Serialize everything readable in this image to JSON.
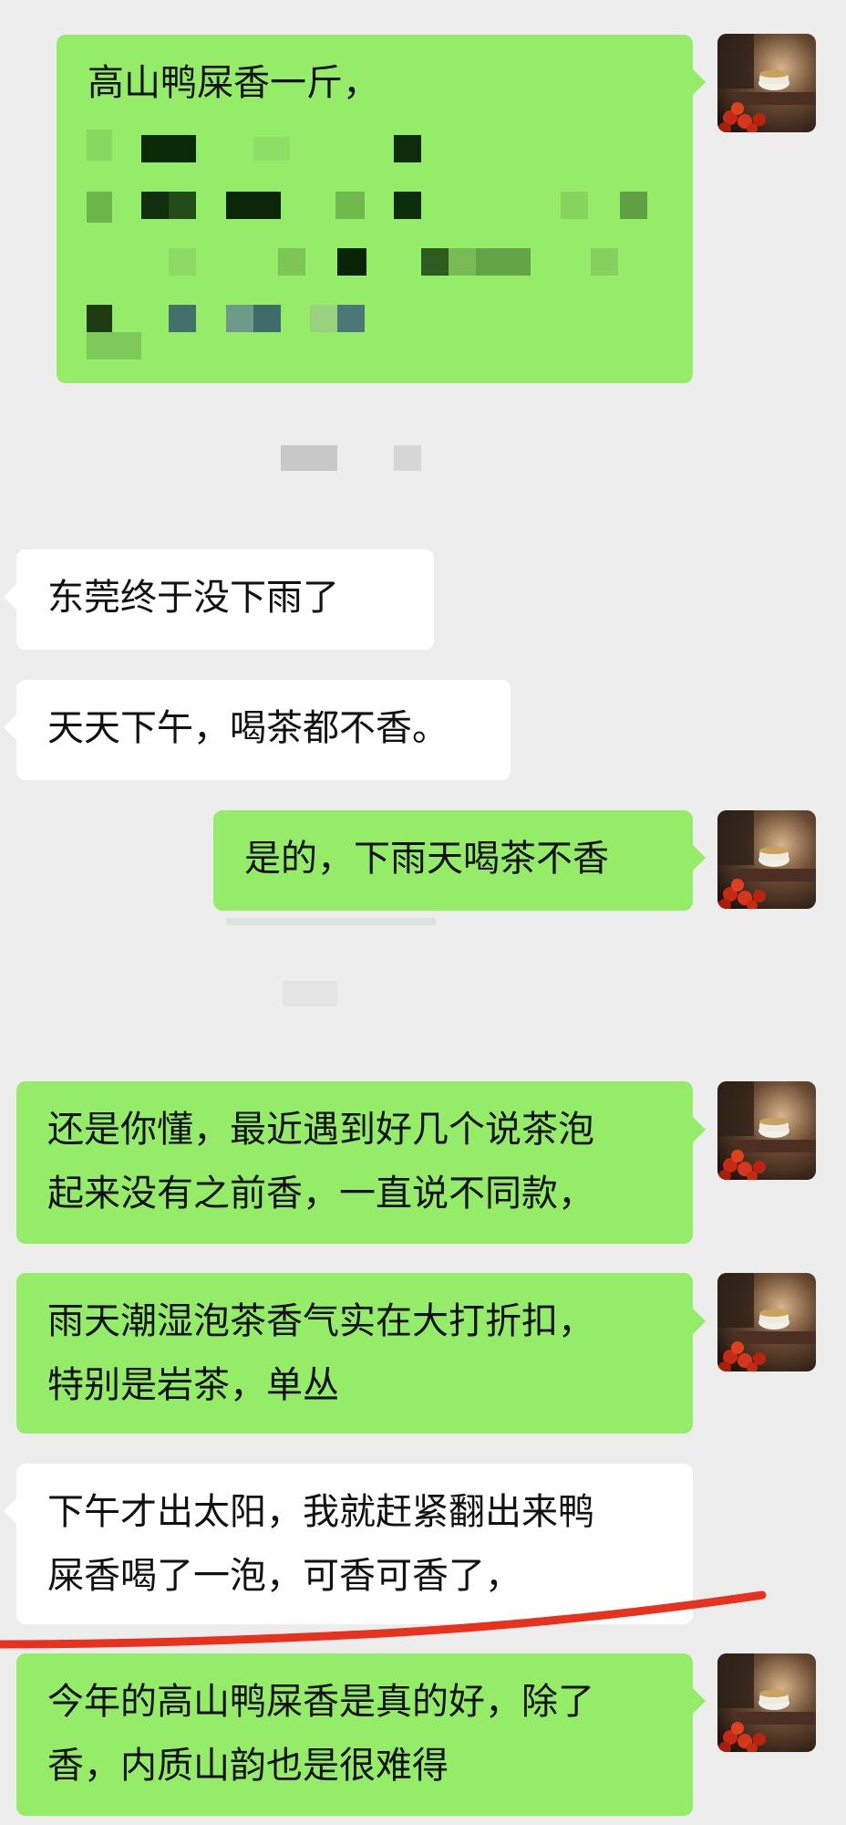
{
  "colors": {
    "background": "#ededed",
    "self_bubble": "#95ec69",
    "other_bubble": "#ffffff",
    "underline_annotation": "#e8321e"
  },
  "messages": [
    {
      "side": "self",
      "lines": [
        "高山鸭屎香一斤，"
      ],
      "redacted": true
    },
    {
      "side": "other",
      "lines": [
        "东莞终于没下雨了"
      ]
    },
    {
      "side": "other",
      "lines": [
        "天天下午，喝茶都不香。"
      ]
    },
    {
      "side": "self",
      "lines": [
        "是的，下雨天喝茶不香"
      ]
    },
    {
      "side": "self",
      "lines": [
        "还是你懂，最近遇到好几个说茶泡",
        "起来没有之前香，一直说不同款，"
      ]
    },
    {
      "side": "self",
      "lines": [
        "雨天潮湿泡茶香气实在大打折扣，",
        "特别是岩茶，单丛"
      ]
    },
    {
      "side": "other",
      "lines": [
        "下午才出太阳，我就赶紧翻出来鸭",
        "屎香喝了一泡，可香可香了，"
      ]
    },
    {
      "side": "self",
      "lines": [
        "今年的高山鸭屎香是真的好，除了",
        "香，内质山韵也是很难得"
      ]
    }
  ],
  "avatar": {
    "icon": "tea-cup-photo-avatar"
  }
}
